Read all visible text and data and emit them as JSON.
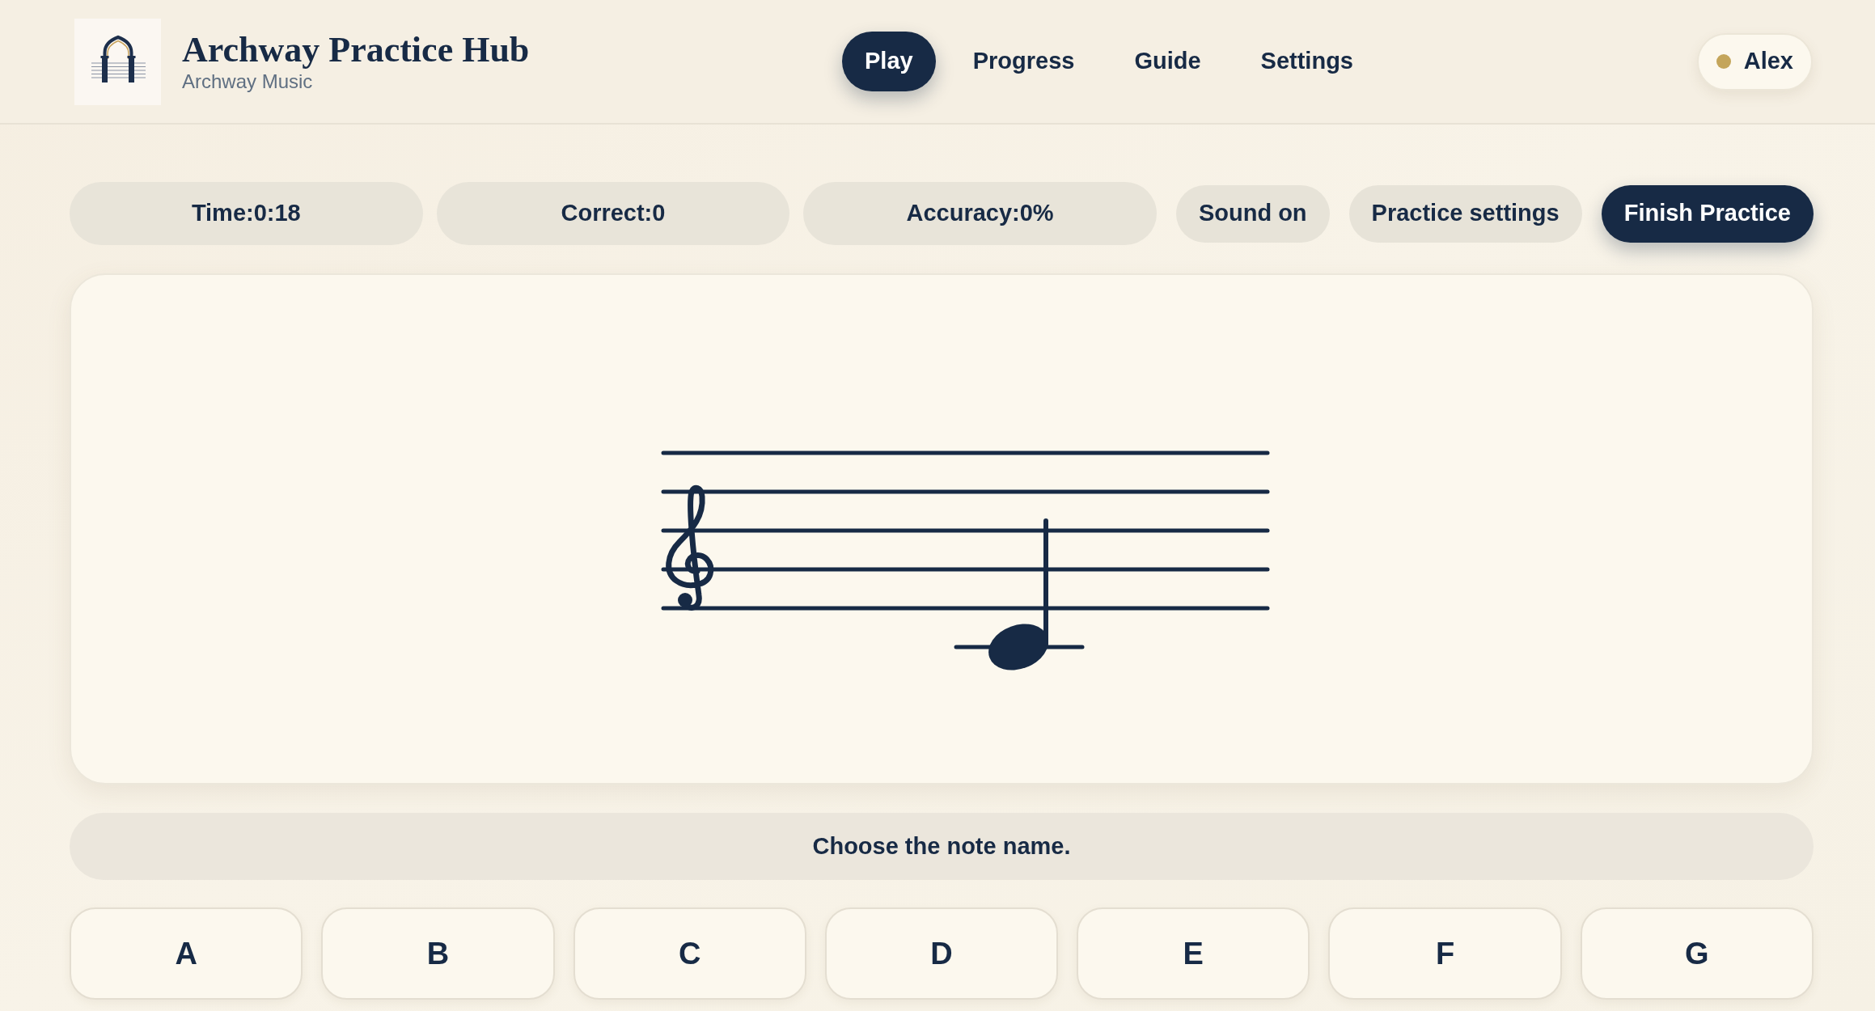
{
  "header": {
    "title": "Archway Practice Hub",
    "subtitle": "Archway Music",
    "nav": [
      {
        "label": "Play",
        "selected": true
      },
      {
        "label": "Progress",
        "selected": false
      },
      {
        "label": "Guide",
        "selected": false
      },
      {
        "label": "Settings",
        "selected": false
      }
    ],
    "user": {
      "name": "Alex"
    }
  },
  "stats": [
    "Time:0:18",
    "Correct:0",
    "Accuracy:0%"
  ],
  "actions": [
    {
      "label": "Sound on",
      "kind": "secondary"
    },
    {
      "label": "Practice settings",
      "kind": "secondary"
    },
    {
      "label": "Finish Practice",
      "kind": "primary"
    }
  ],
  "staff": {
    "clef": {
      "kind": "treble"
    },
    "note": {
      "kind": "quarter"
    }
  },
  "prompt": "Choose the note name.",
  "answers": [
    "A",
    "B",
    "C",
    "D",
    "E",
    "F",
    "G"
  ]
}
